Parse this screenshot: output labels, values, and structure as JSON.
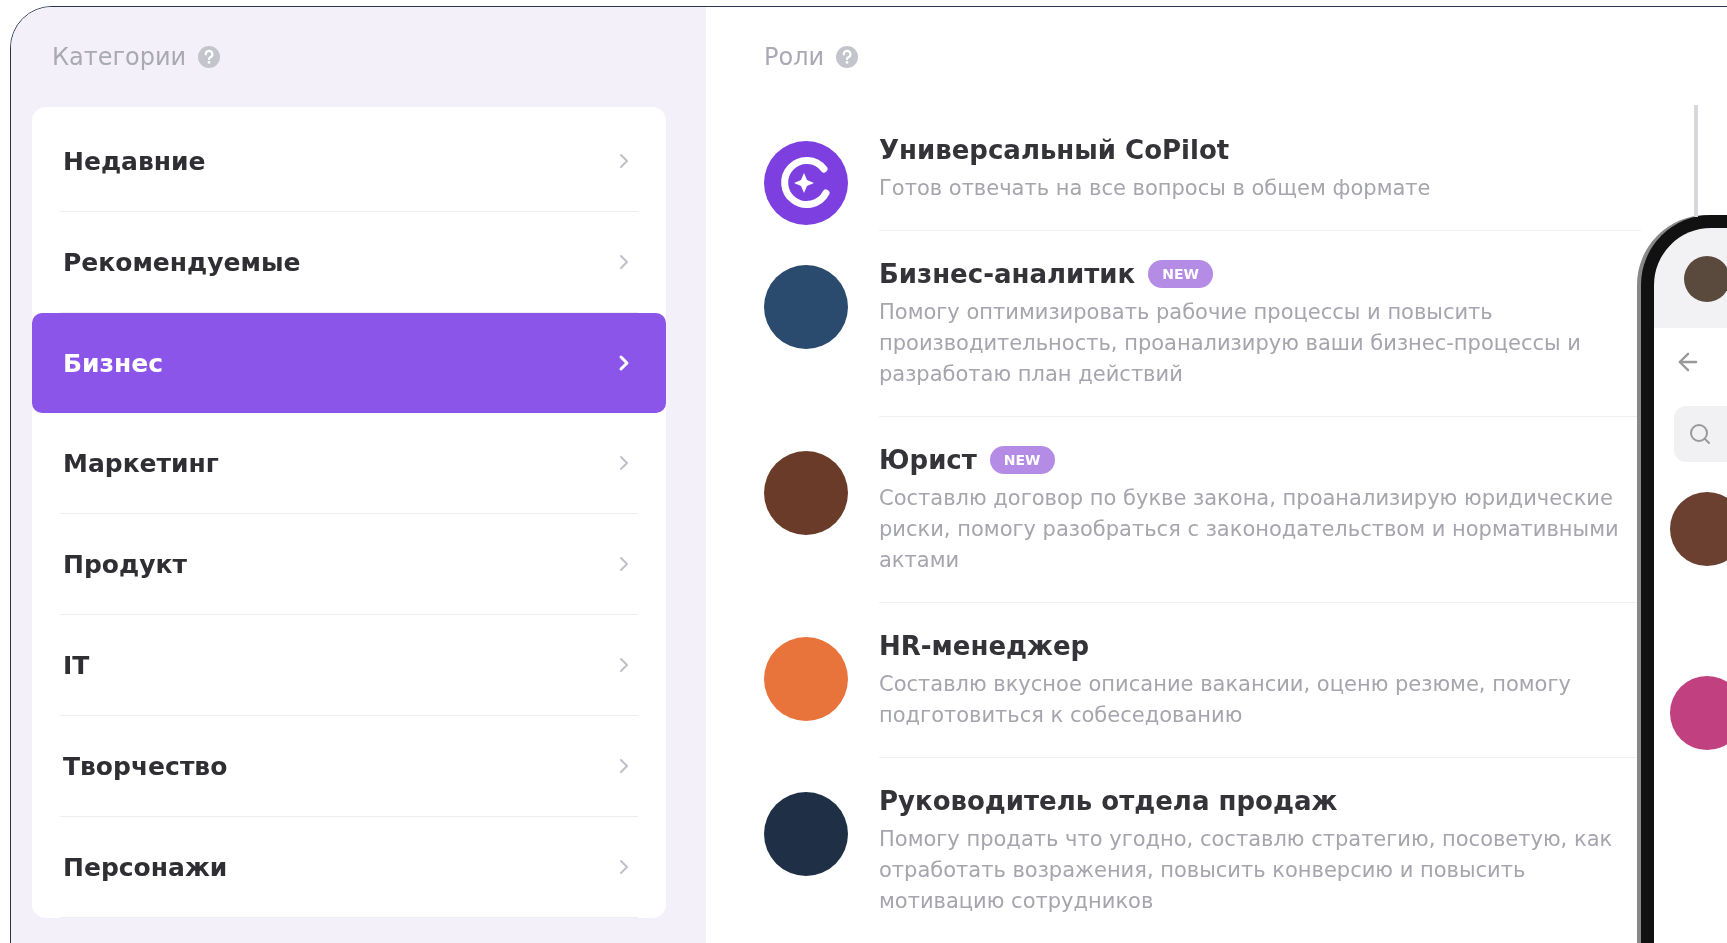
{
  "categories": {
    "title": "Категории",
    "items": [
      {
        "label": "Недавние",
        "selected": false
      },
      {
        "label": "Рекомендуемые",
        "selected": false
      },
      {
        "label": "Бизнес",
        "selected": true
      },
      {
        "label": "Маркетинг",
        "selected": false
      },
      {
        "label": "Продукт",
        "selected": false
      },
      {
        "label": "IT",
        "selected": false
      },
      {
        "label": "Творчество",
        "selected": false
      },
      {
        "label": "Персонажи",
        "selected": false
      }
    ]
  },
  "roles": {
    "title": "Роли",
    "items": [
      {
        "kind": "logo",
        "name": "Универсальный CoPilot",
        "description": "Готов отвечать на все вопросы в общем формате"
      },
      {
        "kind": "photo",
        "name": "Бизнес-аналитик",
        "badge": "NEW",
        "description": "Помогу оптимизировать рабочие процессы и повысить производительность, проанализирую ваши бизнес-процессы и разработаю план действий",
        "color": "#2a4a6e"
      },
      {
        "kind": "photo",
        "name": "Юрист",
        "badge": "NEW",
        "description": "Составлю договор по букве закона, проанализирую юридические риски, помогу разобраться с законодательством и нормативными актами",
        "color": "#6b3b2a"
      },
      {
        "kind": "photo",
        "name": "HR-менеджер",
        "description": "Составлю вкусное описание вакансии, оценю резюме, помогу подготовиться к собеседованию",
        "color": "#e8743c"
      },
      {
        "kind": "photo",
        "name": "Руководитель отдела продаж",
        "description": "Помогу продать что угодно, составлю стратегию, посоветую, как отработать возражения, повысить конверсию и повысить мотивацию сотрудников",
        "color": "#1f3046"
      }
    ]
  }
}
